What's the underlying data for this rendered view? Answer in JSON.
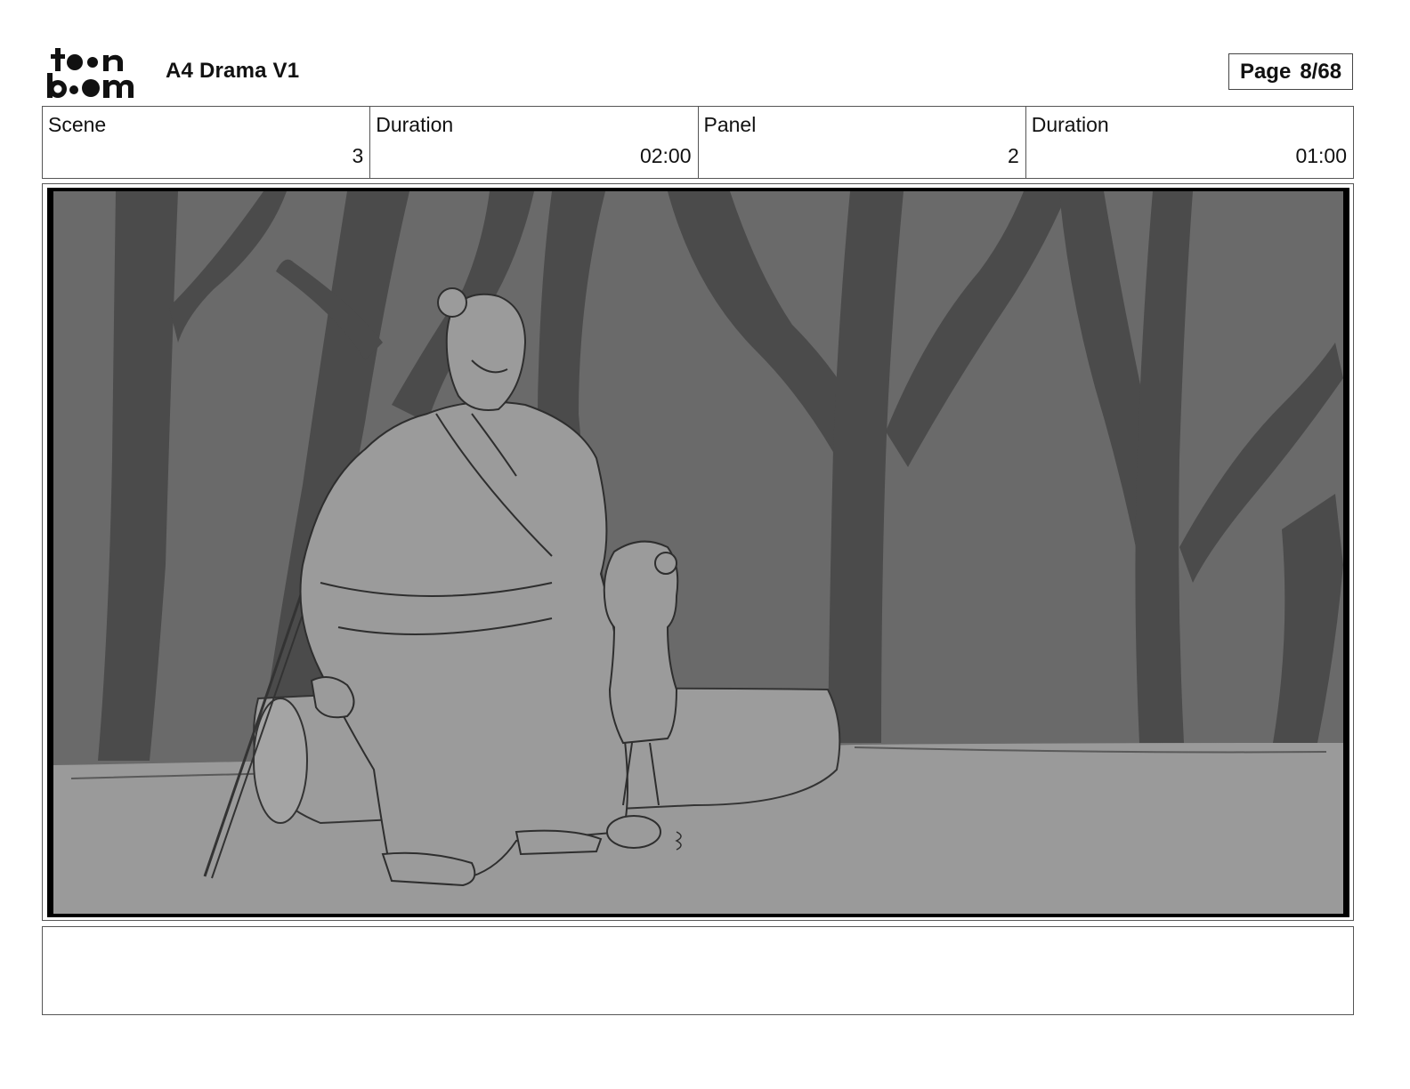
{
  "header": {
    "logo_icon": "toonboom-logo",
    "project_title": "A4 Drama V1",
    "page_label": "Page",
    "page_number": "8/68"
  },
  "info": {
    "scene_label": "Scene",
    "scene_value": "3",
    "scene_duration_label": "Duration",
    "scene_duration_value": "02:00",
    "panel_label": "Panel",
    "panel_value": "2",
    "panel_duration_label": "Duration",
    "panel_duration_value": "01:00"
  },
  "colors": {
    "background": "#ffffff",
    "border": "#555555",
    "frame_black": "#000000",
    "sky": "#6a6a6a",
    "trees": "#4b4b4b",
    "ground": "#9a9a9a",
    "figure_fill": "#9b9b9b",
    "sketch_line": "#2e2e2e"
  },
  "notes": {
    "text": ""
  }
}
